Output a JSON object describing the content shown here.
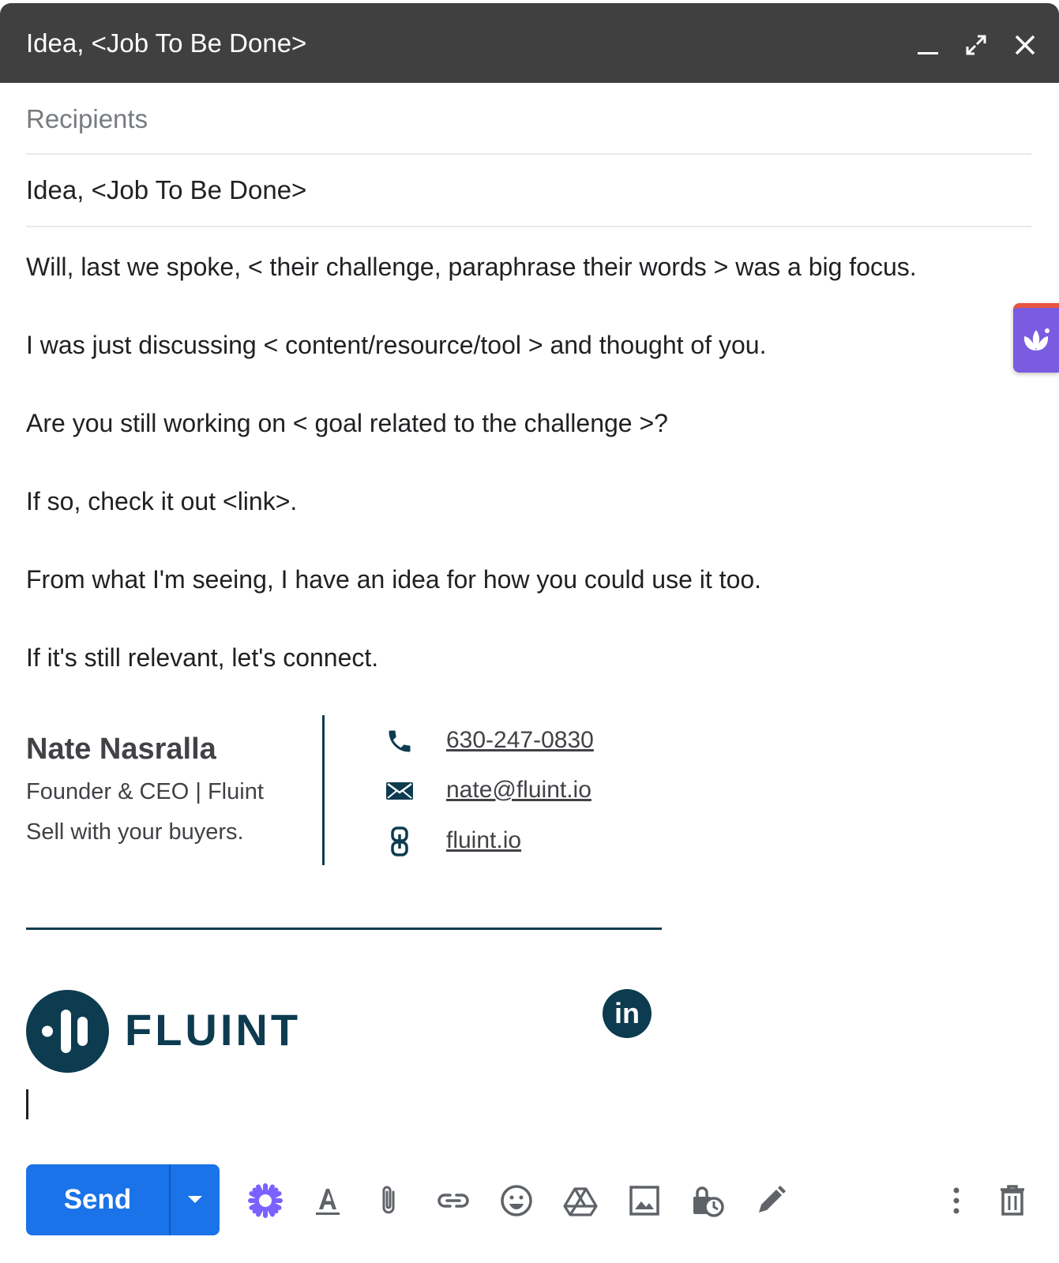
{
  "window": {
    "title": "Idea, <Job To Be Done>",
    "minimize_icon": "minimize-icon",
    "expand_icon": "expand-icon",
    "close_icon": "close-icon"
  },
  "compose": {
    "recipients_placeholder": "Recipients",
    "subject": "Idea, <Job To Be Done>",
    "body": [
      "Will, last we spoke, < their challenge, paraphrase their words > was a big focus.",
      "I was just discussing < content/resource/tool > and thought of you.",
      "Are you still working on < goal related to the challenge >?",
      "If so, check it out <link>.",
      "From what I'm seeing, I have an idea for how you could use it too.",
      "If it's still relevant, let's connect."
    ]
  },
  "signature": {
    "name": "Nate Nasralla",
    "role": "Founder & CEO | Fluint",
    "tagline": "Sell with your buyers.",
    "phone": "630-247-0830",
    "email": "nate@fluint.io",
    "website": "fluint.io",
    "logo_text": "FLUINT",
    "linkedin": "in"
  },
  "toolbar": {
    "send_label": "Send",
    "tools": [
      "ai-assist-icon",
      "format-text-icon",
      "attach-icon",
      "link-icon",
      "emoji-icon",
      "drive-icon",
      "photo-icon",
      "confidential-mode-icon",
      "signature-icon",
      "more-options-icon",
      "delete-icon"
    ]
  },
  "colors": {
    "titlebar": "#404040",
    "send": "#1a73e8",
    "brand": "#0d3b4f",
    "widget": "#7b5be0",
    "ai_icon": "#7b61ff"
  }
}
